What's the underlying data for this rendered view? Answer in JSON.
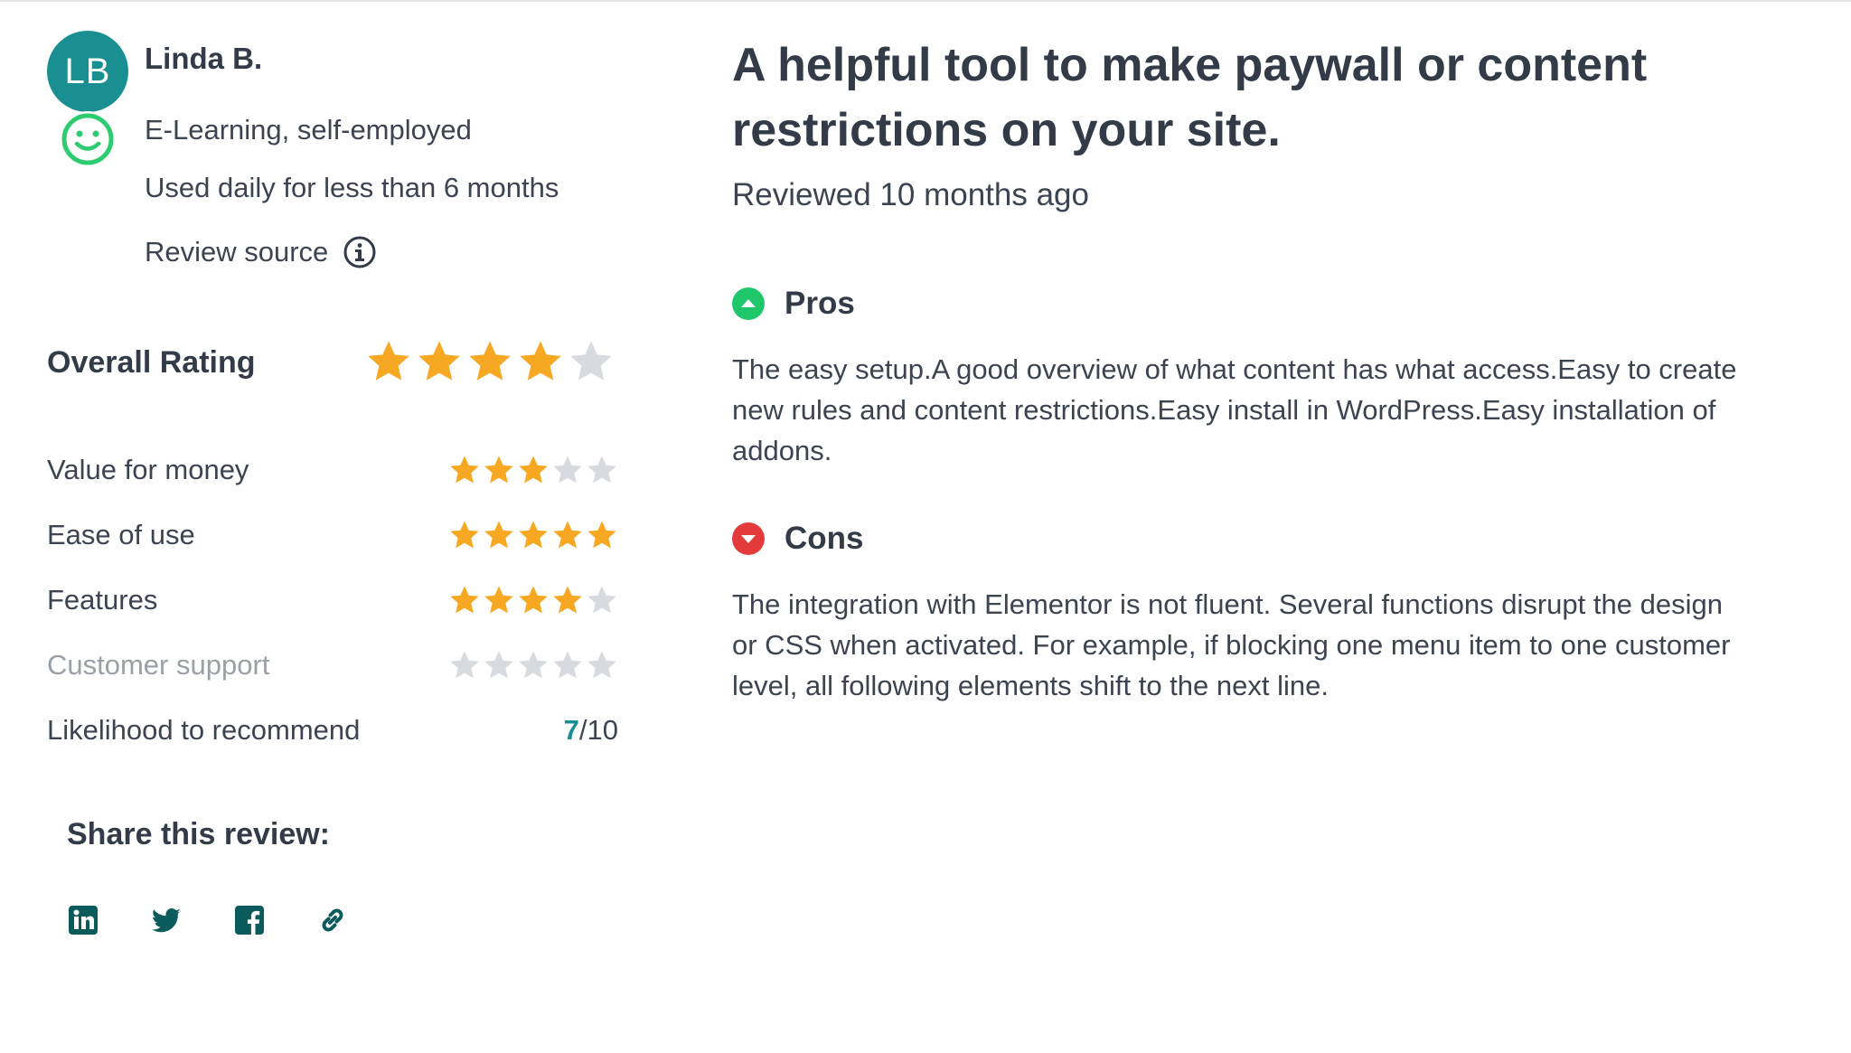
{
  "reviewer": {
    "initials": "LB",
    "name": "Linda B.",
    "industry": "E-Learning, self-employed",
    "usage": "Used daily for less than 6 months",
    "source_label": "Review source"
  },
  "ratings": {
    "overall_label": "Overall Rating",
    "overall_stars": 4,
    "max_stars": 5,
    "categories": [
      {
        "label": "Value for money",
        "stars": 3,
        "muted": false
      },
      {
        "label": "Ease of use",
        "stars": 5,
        "muted": false
      },
      {
        "label": "Features",
        "stars": 4,
        "muted": false
      },
      {
        "label": "Customer support",
        "stars": 0,
        "muted": true
      }
    ],
    "recommend_label": "Likelihood to recommend",
    "recommend_score": "7",
    "recommend_max": "/10"
  },
  "share": {
    "title": "Share this review:",
    "icons": [
      "linkedin-icon",
      "twitter-icon",
      "facebook-icon",
      "link-icon"
    ]
  },
  "review": {
    "title": "A helpful tool to make paywall or content restrictions on your site.",
    "date": "Reviewed 10 months ago",
    "pros_label": "Pros",
    "pros_text": "The easy setup.A good overview of what content has what access.Easy to create new rules and content restrictions.Easy install in WordPress.Easy installation of addons.",
    "cons_label": "Cons",
    "cons_text": "The integration with Elementor is not fluent. Several functions disrupt the design or CSS when activated. For example, if blocking one menu item to one customer level, all following elements shift to the next line."
  },
  "colors": {
    "star_filled": "#f7a823",
    "star_empty": "#d7dade",
    "accent_teal": "#198f92",
    "pros_green": "#1fc76a",
    "cons_red": "#e33b3b",
    "smiley_green": "#2dcc70"
  }
}
